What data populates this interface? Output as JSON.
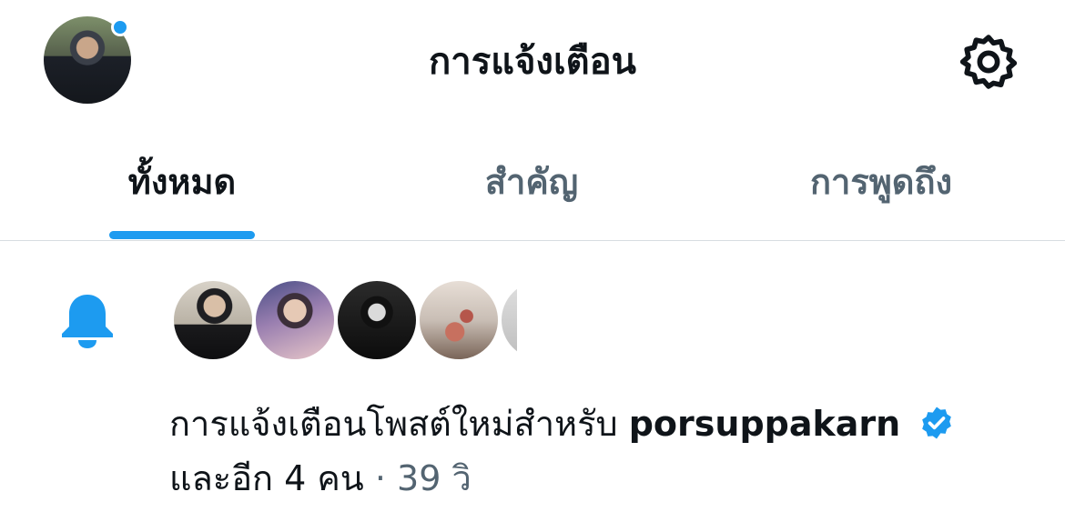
{
  "header": {
    "title": "การแจ้งเตือน",
    "avatar_icon": "user-avatar",
    "settings_icon": "gear-icon"
  },
  "tabs": [
    {
      "label": "ทั้งหมด",
      "active": true
    },
    {
      "label": "สำคัญ",
      "active": false
    },
    {
      "label": "การพูดถึง",
      "active": false
    }
  ],
  "notification": {
    "icon": "bell-icon",
    "message": "การแจ้งเตือนโพสต์ใหม่สำหรับ",
    "account": "porsuppakarn",
    "others": "และอีก 4 คน",
    "separator": "·",
    "time": "39 วิ"
  },
  "colors": {
    "accent": "#1d9bf0",
    "text": "#0f1419",
    "muted": "#536471"
  }
}
